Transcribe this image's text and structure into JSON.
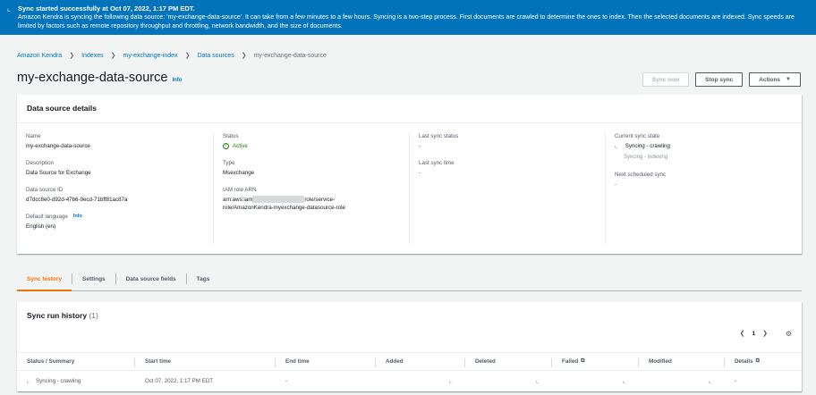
{
  "flash": {
    "icon": "spinner-icon",
    "title": "Sync started successfully at Oct 07, 2022, 1:17 PM EDT.",
    "message": "Amazon Kendra is syncing the following data source: 'my-exchange-data-source'. It can take from a few minutes to a few hours. Syncing is a two-step process. First documents are crawled to determine the ones to index. Then the selected documents are indexed. Sync speeds are limited by factors such as remote repository throughput and throttling, network bandwidth, and the size of documents."
  },
  "breadcrumbs": [
    "Amazon Kendra",
    "Indexes",
    "my-exchange-index",
    "Data sources",
    "my-exchange-data-source"
  ],
  "header": {
    "title": "my-exchange-data-source",
    "info": "Info",
    "sync_now": "Sync now",
    "stop_sync": "Stop sync",
    "actions": "Actions"
  },
  "details": {
    "title": "Data source details",
    "name_label": "Name",
    "name_value": "my-exchange-data-source",
    "description_label": "Description",
    "description_value": "Data Source for Exchange",
    "id_label": "Data source ID",
    "id_value": "d7dcc8e0-d92d-47b6-9ecd-71bff81ac87a",
    "language_label": "Default language",
    "language_info": "Info",
    "language_value": "English (en)",
    "status_label": "Status",
    "status_value": "Active",
    "type_label": "Type",
    "type_value": "Msexchange",
    "iam_label": "IAM role ARN",
    "iam_prefix": "arn:aws:iam",
    "iam_suffix": "role/service-",
    "iam_line2": "role/AmazonKendra-myexchange-datasource-role",
    "last_sync_status_label": "Last sync status",
    "last_sync_status_value": "-",
    "last_sync_time_label": "Last sync time",
    "last_sync_time_value": "-",
    "current_state_label": "Current sync state",
    "current_state_value": "Syncing - crawling",
    "current_state_next": "Syncing - indexing",
    "next_sync_label": "Next scheduled sync",
    "next_sync_value": "-"
  },
  "tabs": [
    "Sync history",
    "Settings",
    "Data source fields",
    "Tags"
  ],
  "history": {
    "title": "Sync run history",
    "count": "(1)",
    "page": "1",
    "columns": [
      "Status / Summary",
      "Start time",
      "End time",
      "Added",
      "Deleted",
      "Failed",
      "Modified",
      "Details"
    ],
    "row": {
      "status": "Syncing - crawling",
      "start": "Oct 07, 2022, 1:17 PM EDT",
      "end": "-",
      "details": "-"
    }
  },
  "colors": {
    "brand_blue": "#0073bb",
    "accent_orange": "#ec7211",
    "success_green": "#1d8102"
  }
}
